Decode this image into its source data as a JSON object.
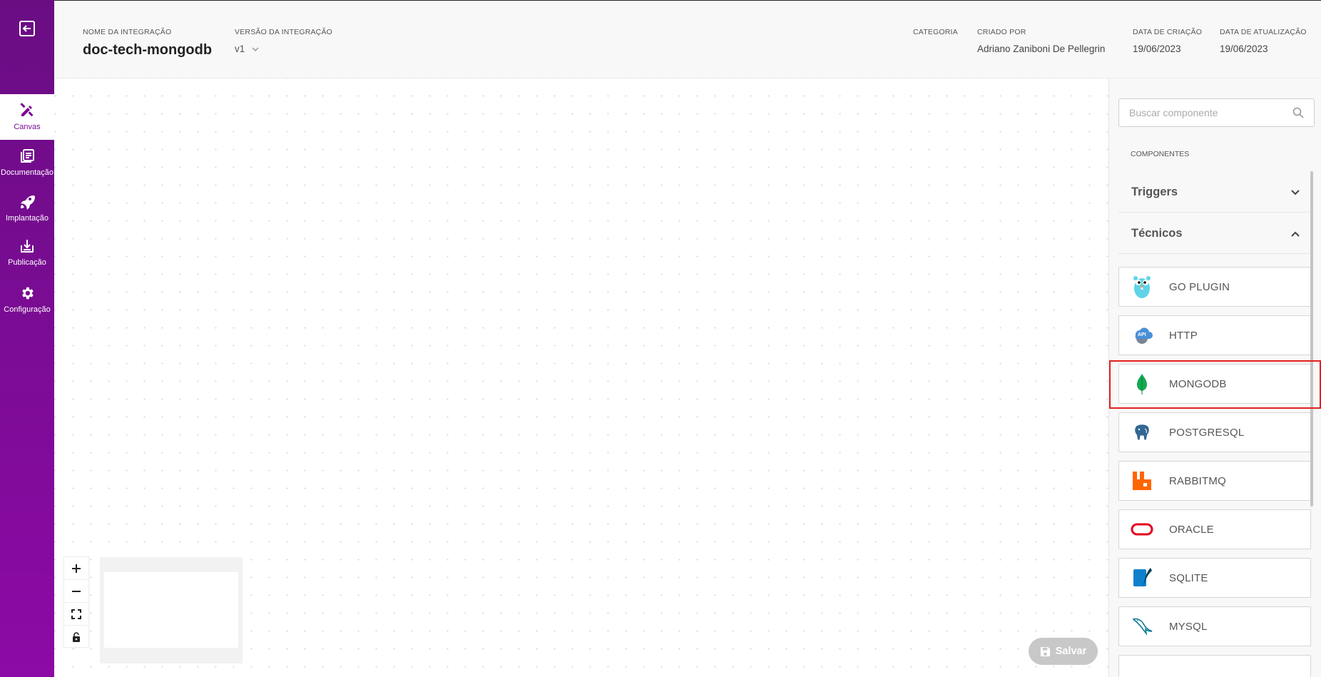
{
  "sidebar": {
    "items": [
      {
        "label": "Canvas",
        "icon": "pencil-ruler-icon",
        "active": true
      },
      {
        "label": "Documentação",
        "icon": "book-icon"
      },
      {
        "label": "Implantação",
        "icon": "rocket-icon"
      },
      {
        "label": "Publicação",
        "icon": "download-tray-icon"
      },
      {
        "label": "Configuração",
        "icon": "gear-icon"
      }
    ]
  },
  "header": {
    "name_label": "NOME DA INTEGRAÇÃO",
    "name_value": "doc-tech-mongodb",
    "version_label": "VERSÃO DA INTEGRAÇÃO",
    "version_value": "v1",
    "category_label": "CATEGORIA",
    "created_by_label": "CRIADO POR",
    "created_by_value": "Adriano Zaniboni De Pellegrin",
    "created_date_label": "DATA DE CRIAÇÃO",
    "created_date_value": "19/06/2023",
    "updated_date_label": "DATA DE ATUALIZAÇÃO",
    "updated_date_value": "19/06/2023"
  },
  "canvas": {
    "save_label": "Salvar"
  },
  "panel": {
    "search_placeholder": "Buscar componente",
    "section_title": "COMPONENTES",
    "groups": [
      {
        "title": "Triggers",
        "expanded": false
      },
      {
        "title": "Técnicos",
        "expanded": true
      }
    ],
    "components": [
      {
        "name": "GO PLUGIN",
        "icon": "gopher-icon"
      },
      {
        "name": "HTTP",
        "icon": "api-cloud-icon"
      },
      {
        "name": "MONGODB",
        "icon": "mongodb-leaf-icon"
      },
      {
        "name": "POSTGRESQL",
        "icon": "postgresql-elephant-icon"
      },
      {
        "name": "RABBITMQ",
        "icon": "rabbitmq-icon"
      },
      {
        "name": "ORACLE",
        "icon": "oracle-icon"
      },
      {
        "name": "SQLITE",
        "icon": "sqlite-icon"
      },
      {
        "name": "MYSQL",
        "icon": "mysql-dolphin-icon"
      }
    ]
  },
  "colors": {
    "brand_purple": "#7a0b95",
    "highlight_red": "#e02020",
    "mongodb_green": "#13aa52",
    "rabbitmq_orange": "#ff6600",
    "oracle_red": "#e3001b"
  }
}
